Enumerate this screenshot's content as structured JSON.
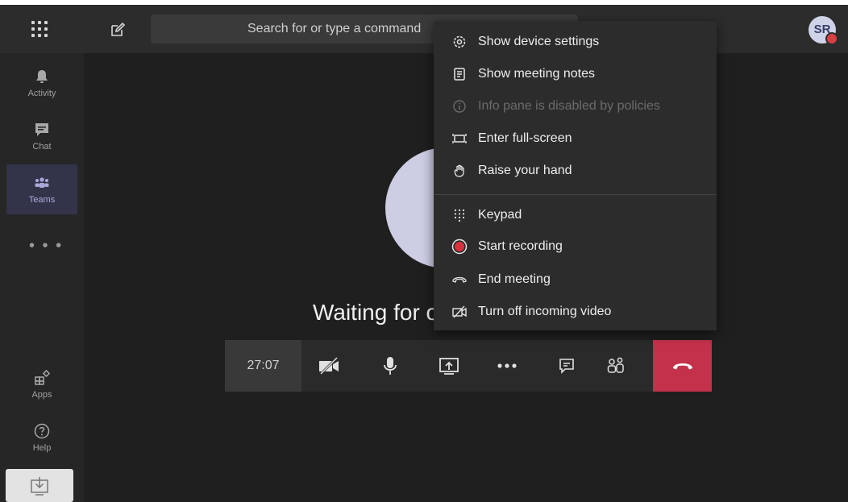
{
  "topbar": {
    "search_placeholder": "Search for or type a command",
    "avatar_initials": "SR",
    "presence_color": "#d64045"
  },
  "rail": {
    "items": [
      {
        "label": "Activity",
        "icon": "bell-icon"
      },
      {
        "label": "Chat",
        "icon": "chat-icon"
      },
      {
        "label": "Teams",
        "icon": "teams-icon",
        "active": true
      },
      {
        "label": "Apps",
        "icon": "apps-icon"
      },
      {
        "label": "Help",
        "icon": "help-icon"
      }
    ],
    "more_label": "• • •"
  },
  "stage": {
    "waiting_text": "Waiting for others to join..."
  },
  "controls": {
    "timer": "27:07",
    "buttons": [
      "camera-off-icon",
      "microphone-icon",
      "share-screen-icon",
      "more-icon",
      "chat-icon",
      "participants-icon",
      "hang-up-icon"
    ],
    "hangup_color": "#c4314b"
  },
  "menu": {
    "items": [
      {
        "label": "Show device settings",
        "icon": "gear-icon"
      },
      {
        "label": "Show meeting notes",
        "icon": "notes-icon"
      },
      {
        "label": "Info pane is disabled by policies",
        "icon": "info-icon",
        "disabled": true
      },
      {
        "label": "Enter full-screen",
        "icon": "fullscreen-icon"
      },
      {
        "label": "Raise your hand",
        "icon": "hand-icon"
      },
      {
        "label": "Keypad",
        "icon": "keypad-icon"
      },
      {
        "label": "Start recording",
        "icon": "record-icon"
      },
      {
        "label": "End meeting",
        "icon": "end-meeting-icon"
      },
      {
        "label": "Turn off incoming video",
        "icon": "video-off-icon"
      }
    ]
  }
}
